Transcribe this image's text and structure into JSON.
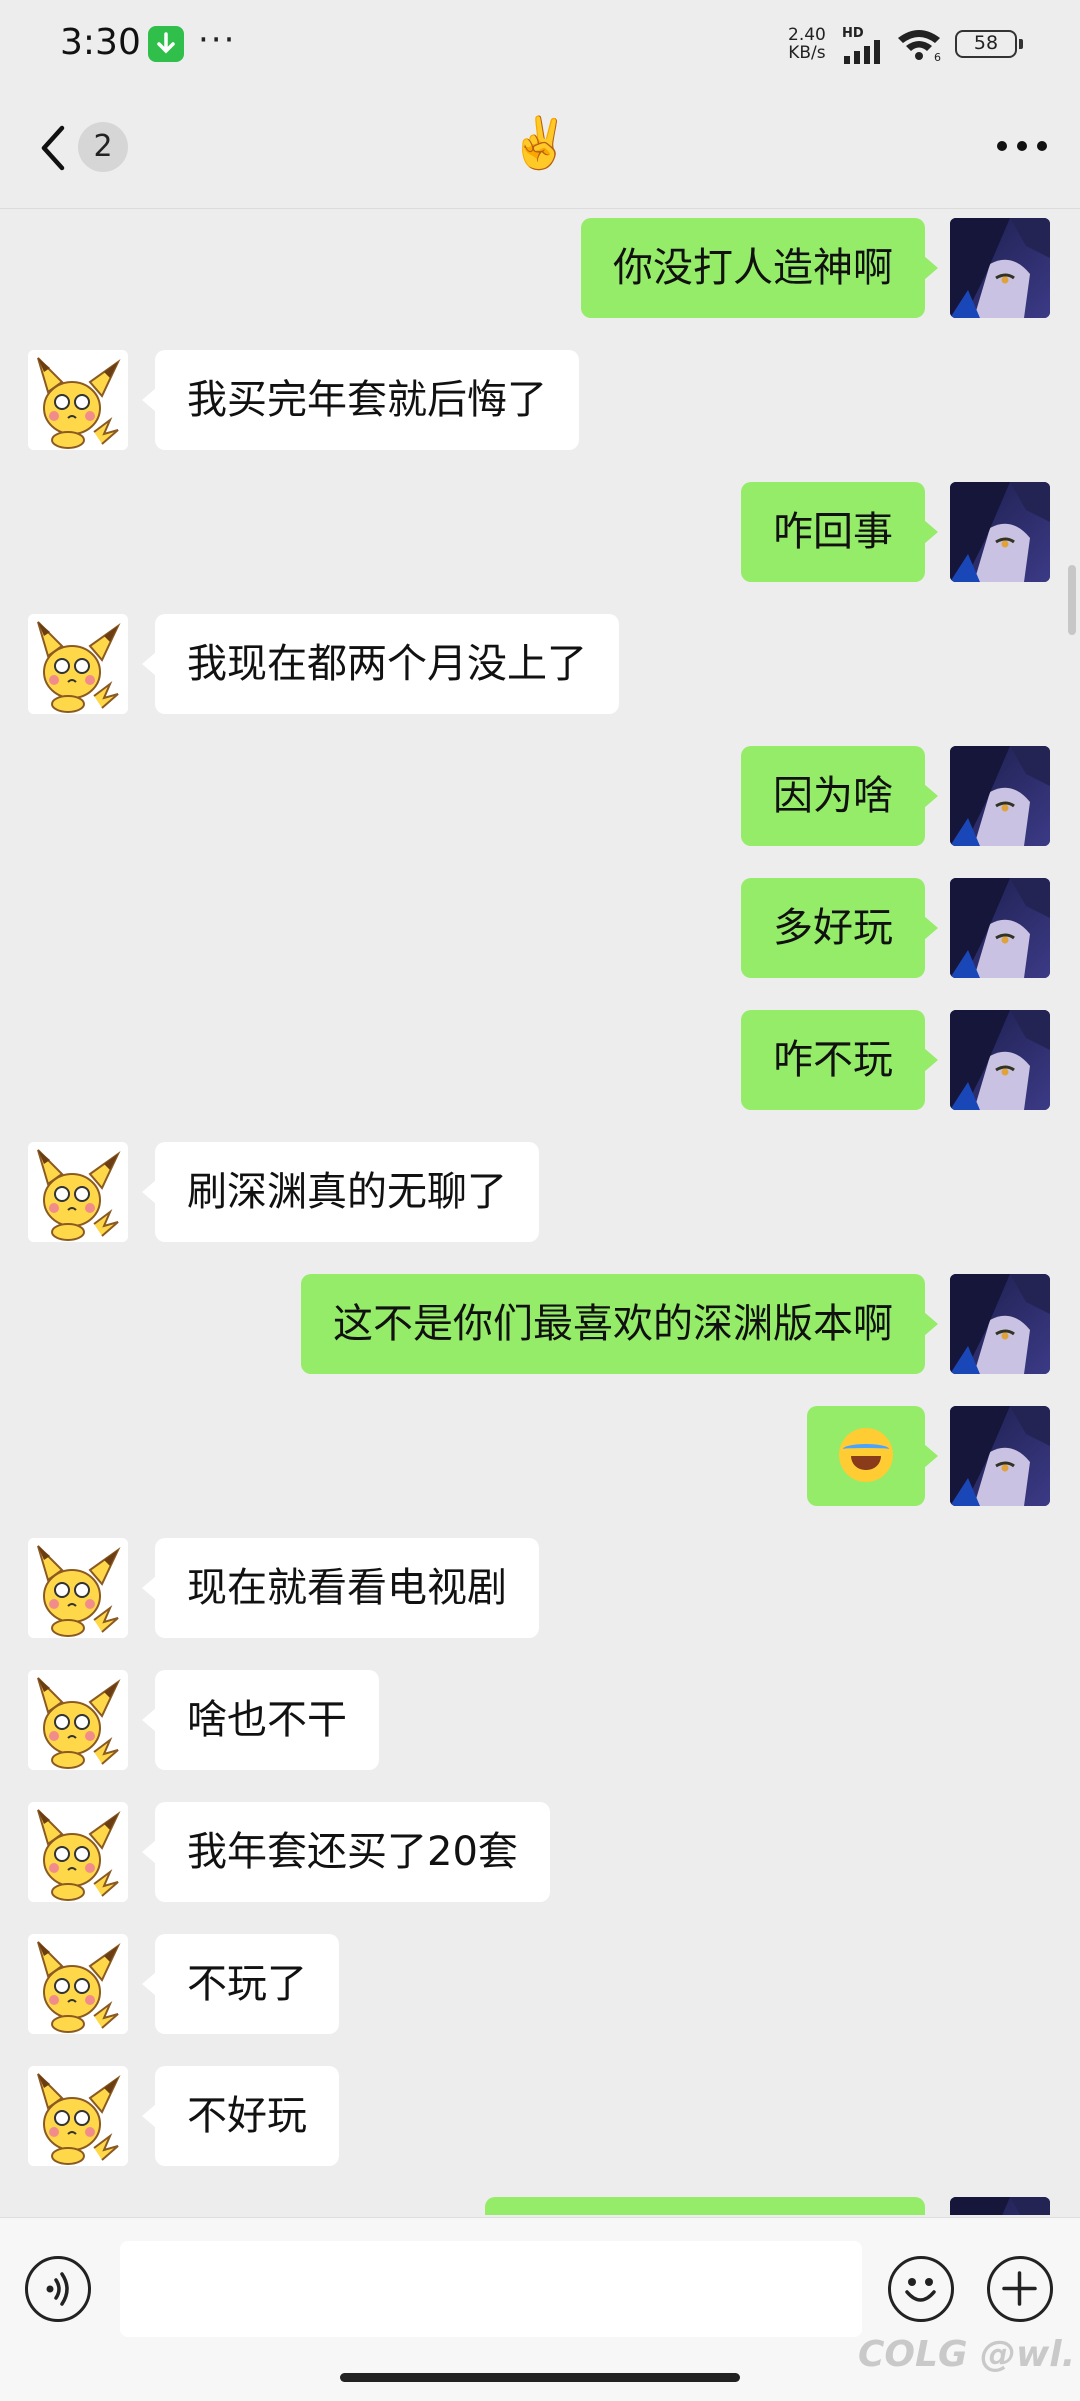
{
  "status_bar": {
    "time": "3:30",
    "dots": "···",
    "net_speed_value": "2.40",
    "net_speed_unit": "KB/s",
    "hd_label": "HD",
    "wifi_label": "6",
    "battery_percent": "58",
    "icons": [
      "download-icon",
      "signal-icon",
      "wifi-icon",
      "battery-icon"
    ]
  },
  "header": {
    "back_icon": "chevron-left-icon",
    "unread_count": "2",
    "title": "✌️",
    "more_icon": "more-horizontal-icon"
  },
  "messages": [
    {
      "side": "out",
      "text": "你没打人造神啊"
    },
    {
      "side": "in",
      "text": "我买完年套就后悔了"
    },
    {
      "side": "out",
      "text": "咋回事"
    },
    {
      "side": "in",
      "text": "我现在都两个月没上了"
    },
    {
      "side": "out",
      "text": "因为啥"
    },
    {
      "side": "out",
      "text": "多好玩"
    },
    {
      "side": "out",
      "text": "咋不玩"
    },
    {
      "side": "in",
      "text": "刷深渊真的无聊了"
    },
    {
      "side": "out",
      "text": "这不是你们最喜欢的深渊版本啊"
    },
    {
      "side": "out",
      "emoji": "face-with-tears-of-joy"
    },
    {
      "side": "in",
      "text": "现在就看看电视剧"
    },
    {
      "side": "in",
      "text": "啥也不干"
    },
    {
      "side": "in",
      "text": "我年套还买了20套"
    },
    {
      "side": "in",
      "text": "不玩了"
    },
    {
      "side": "in",
      "text": "不好玩"
    }
  ],
  "input_bar": {
    "voice_icon": "voice-icon",
    "emoji_icon": "smile-icon",
    "plus_icon": "plus-circle-icon",
    "input_value": ""
  },
  "watermark": "COLG @wl.",
  "colors": {
    "background": "#ededed",
    "bubble_out": "#95ec69",
    "bubble_in": "#ffffff",
    "avatar_out": "#2a2860",
    "avatar_in_character": "#ffd84a"
  }
}
